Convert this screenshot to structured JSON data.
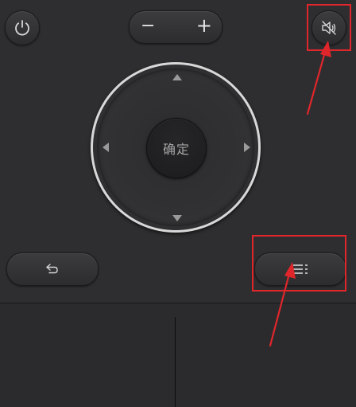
{
  "header": {
    "power_icon": "power-icon",
    "volume": {
      "minus_label": "−",
      "plus_label": "+"
    },
    "mute_icon": "volume-mute-icon"
  },
  "dpad": {
    "ok_label": "确定",
    "up_icon": "arrow-up-icon",
    "down_icon": "arrow-down-icon",
    "left_icon": "arrow-left-icon",
    "right_icon": "arrow-right-icon"
  },
  "footer_buttons": {
    "back_icon": "back-return-icon",
    "menu_icon": "menu-list-icon"
  },
  "annotations": {
    "color": "#e0262b"
  },
  "colors": {
    "background": "#2e2e30",
    "button_text": "#e6e6e6",
    "ring": "#d8d8d8"
  }
}
